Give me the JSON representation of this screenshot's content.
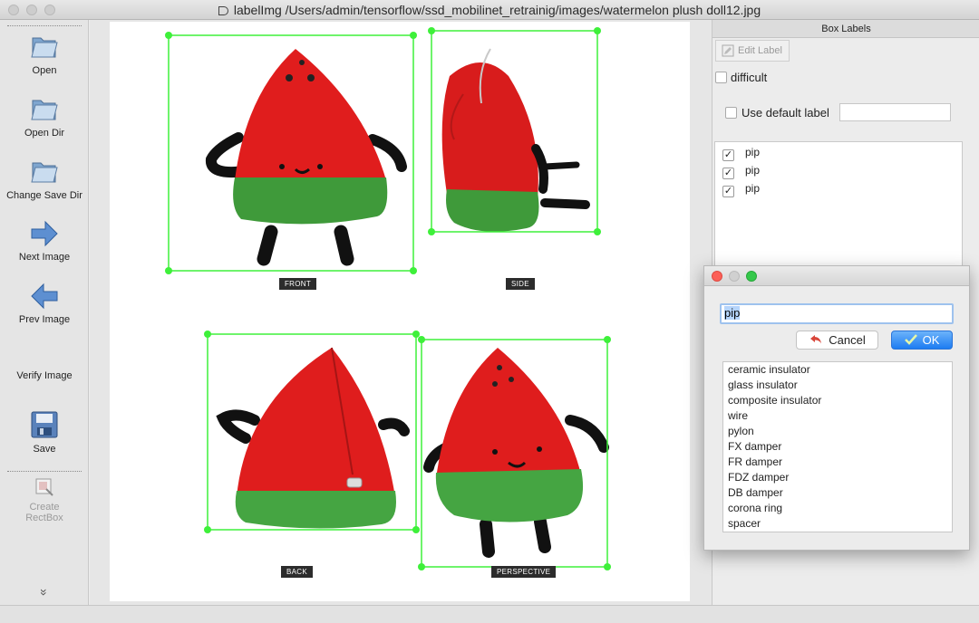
{
  "window": {
    "title": "labelImg /Users/admin/tensorflow/ssd_mobilinet_retrainig/images/watermelon plush doll12.jpg"
  },
  "toolbar": {
    "open": "Open",
    "open_dir": "Open Dir",
    "change_save_dir": "Change Save Dir",
    "next_image": "Next Image",
    "prev_image": "Prev Image",
    "verify_image": "Verify Image",
    "save": "Save",
    "create_rectbox": "Create\nRectBox",
    "more": "»"
  },
  "canvas": {
    "captions": {
      "front": "FRONT",
      "side": "SIDE",
      "back": "BACK",
      "perspective": "PERSPECTIVE"
    },
    "box_color": "#3ef03a"
  },
  "box_labels_panel": {
    "title": "Box Labels",
    "edit_label": "Edit Label",
    "difficult": "difficult",
    "use_default_label": "Use default label",
    "default_label_value": "",
    "labels": [
      {
        "text": "pip",
        "checked": true
      },
      {
        "text": "pip",
        "checked": true
      },
      {
        "text": "pip",
        "checked": true
      }
    ]
  },
  "label_dialog": {
    "input_value": "pip",
    "cancel": "Cancel",
    "ok": "OK",
    "options": [
      "ceramic insulator",
      "glass insulator",
      "composite insulator",
      "wire",
      "pylon",
      "FX damper",
      "FR damper",
      "FDZ damper",
      "DB damper",
      "corona ring",
      "spacer"
    ]
  }
}
